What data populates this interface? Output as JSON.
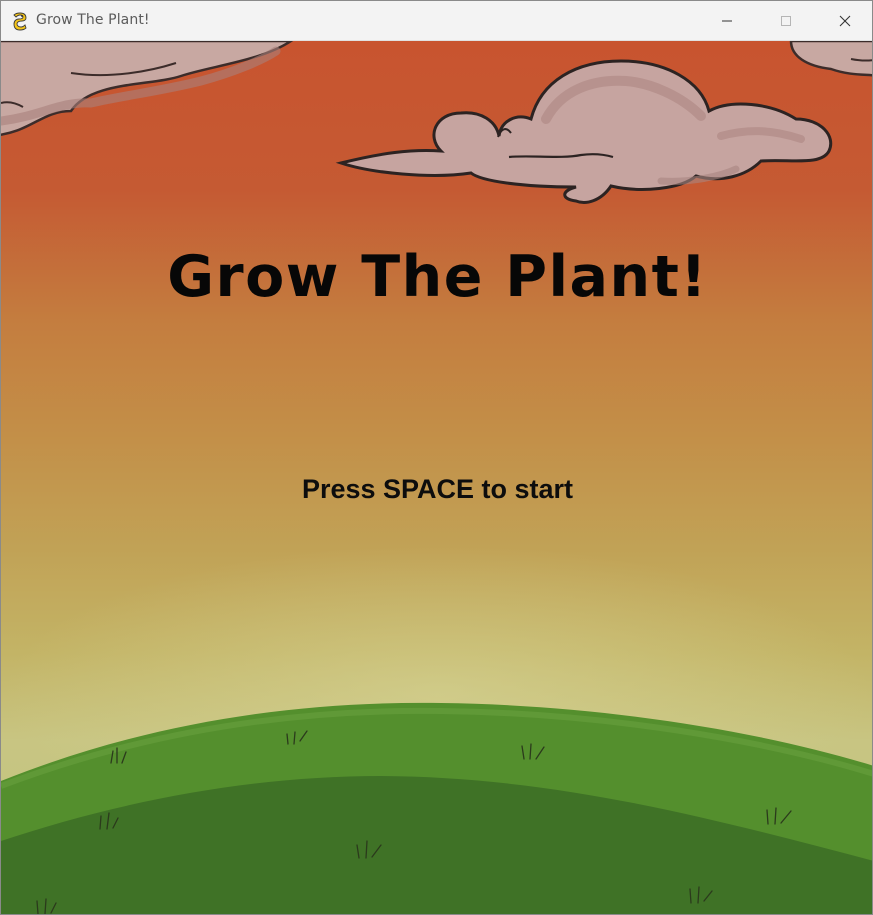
{
  "window": {
    "title": "Grow The Plant!",
    "icon": "pygame-snake-icon",
    "controls": {
      "minimize": "minimize-icon",
      "maximize": "maximize-icon",
      "close": "close-icon"
    }
  },
  "game": {
    "title": "Grow The Plant!",
    "prompt": "Press SPACE to start"
  },
  "colors": {
    "sky_top": "#c8542f",
    "sky_mid": "#c48a45",
    "sky_low": "#c6c282",
    "hill_back": "#538c2c",
    "hill_front": "#3d6f24",
    "cloud": "#c6a4a0",
    "title_text": "#070707"
  }
}
